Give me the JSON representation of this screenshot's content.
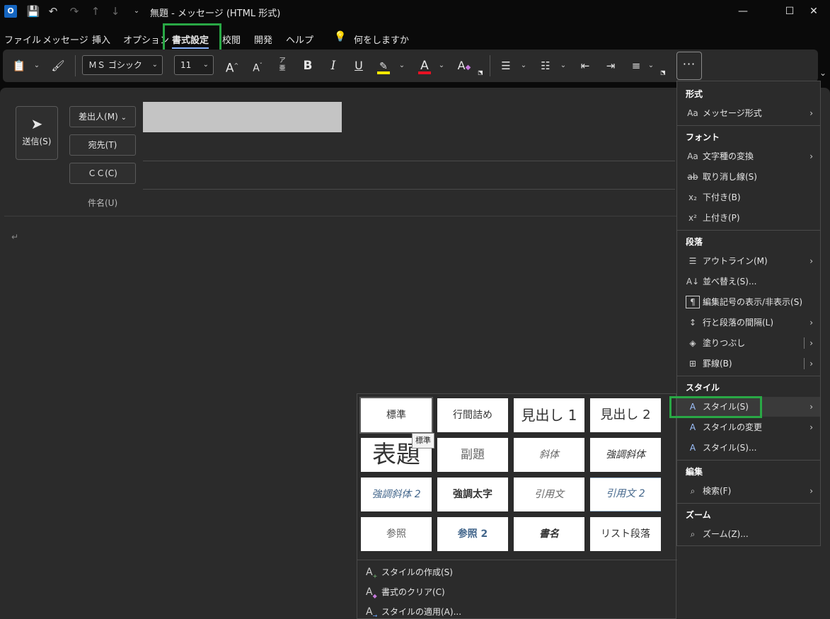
{
  "window": {
    "title": "無題 - メッセージ (HTML 形式)",
    "app_icon_letter": "O",
    "controls": [
      "—",
      "☐",
      "✕"
    ]
  },
  "menu": {
    "tabs": [
      "ファイル",
      "メッセージ",
      "挿入",
      "オプション",
      "書式設定",
      "校閲",
      "開発",
      "ヘルプ"
    ],
    "active_tab": "書式設定",
    "tell_me": "何をしますか"
  },
  "ribbon": {
    "font_name": "ＭＳ ゴシック",
    "font_size": "11",
    "bold": "B",
    "italic": "I",
    "underline": "U",
    "grow": "A",
    "shrink": "A",
    "phonetic_top": "ア",
    "phonetic_bottom": "亜",
    "font_color_letter": "A",
    "clear_format_letter": "A",
    "more": "···",
    "accent_highlight": "#ffe800",
    "accent_font_color": "#e81123"
  },
  "compose": {
    "send_label": "送信(S)",
    "from_label": "差出人(M)",
    "to_label": "宛先(T)",
    "cc_label": "ＣＣ(C)",
    "subject_label": "件名(U)",
    "paragraph_mark": "↵"
  },
  "gallery": {
    "rows": [
      [
        "標準",
        "行間詰め",
        "見出し 1",
        "見出し 2"
      ],
      [
        "表題",
        "副題",
        "斜体",
        "強調斜体"
      ],
      [
        "強調斜体 2",
        "強調太字",
        "引用文",
        "引用文 2"
      ],
      [
        "参照",
        "参照 2",
        "書名",
        "リスト段落"
      ]
    ],
    "tooltip": "標準",
    "actions": [
      {
        "icon": "create-style-icon",
        "label": "スタイルの作成(S)"
      },
      {
        "icon": "clear-format-icon",
        "label": "書式のクリア(C)"
      },
      {
        "icon": "apply-style-icon",
        "label": "スタイルの適用(A)..."
      }
    ]
  },
  "overflow_menu": {
    "sections": [
      {
        "header": "形式",
        "items": [
          {
            "icon": "Aa",
            "label": "メッセージ形式",
            "submenu": true
          }
        ]
      },
      {
        "header": "フォント",
        "items": [
          {
            "icon": "Aa",
            "label": "文字種の変換",
            "submenu": true
          },
          {
            "icon": "ab",
            "label": "取り消し線(S)"
          },
          {
            "icon": "x₂",
            "label": "下付き(B)"
          },
          {
            "icon": "x²",
            "label": "上付き(P)"
          }
        ]
      },
      {
        "header": "段落",
        "items": [
          {
            "icon": "☰",
            "label": "アウトライン(M)",
            "submenu": true
          },
          {
            "icon": "A↓",
            "label": "並べ替え(S)..."
          },
          {
            "icon": "¶",
            "label": "編集記号の表示/非表示(S)"
          },
          {
            "icon": "↕",
            "label": "行と段落の間隔(L)",
            "submenu": true
          },
          {
            "icon": "◈",
            "label": "塗りつぶし",
            "submenu": true
          },
          {
            "icon": "⊞",
            "label": "罫線(B)",
            "submenu": true
          }
        ]
      },
      {
        "header": "スタイル",
        "items": [
          {
            "icon": "A",
            "label": "スタイル(S)",
            "submenu": true
          },
          {
            "icon": "A",
            "label": "スタイルの変更",
            "submenu": true
          },
          {
            "icon": "A",
            "label": "スタイル(S)..."
          }
        ]
      },
      {
        "header": "編集",
        "items": [
          {
            "icon": "⌕",
            "label": "検索(F)",
            "submenu": true
          }
        ]
      },
      {
        "header": "ズーム",
        "items": [
          {
            "icon": "⌕",
            "label": "ズーム(Z)..."
          }
        ]
      }
    ]
  }
}
